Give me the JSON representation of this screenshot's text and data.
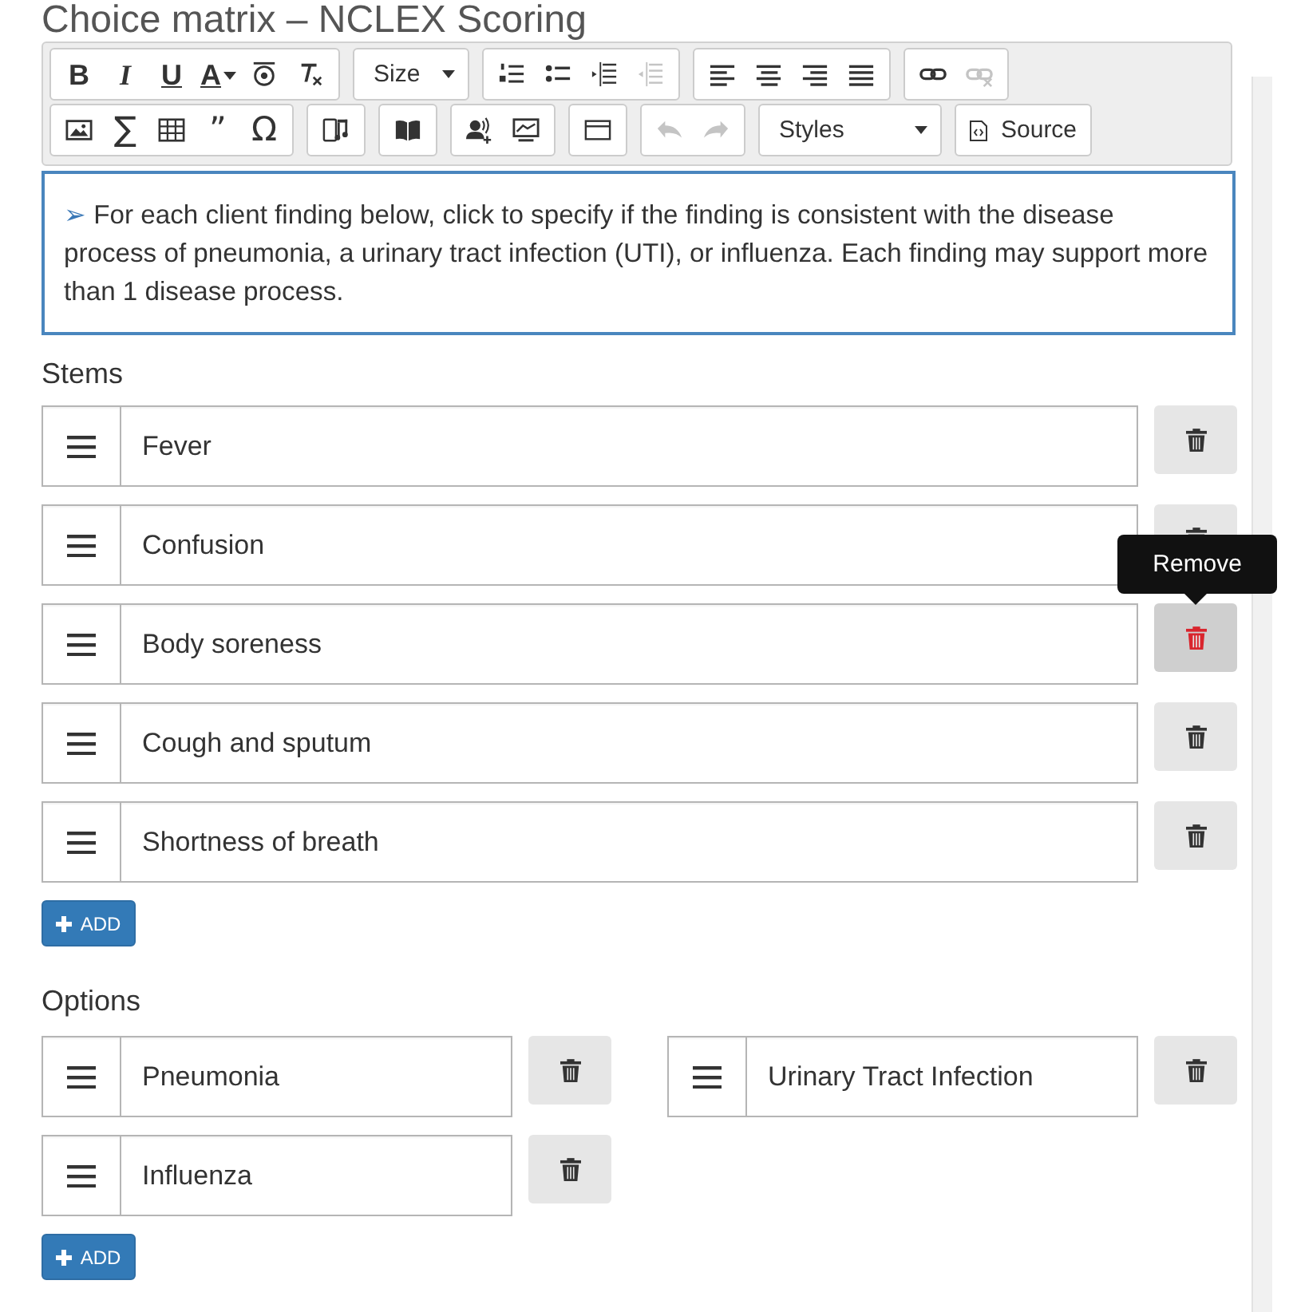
{
  "page_title": "Choice matrix – NCLEX Scoring",
  "toolbar": {
    "rows": [
      [
        {
          "items": [
            {
              "kind": "bold",
              "label": "B",
              "disabled": false
            },
            {
              "kind": "italic",
              "label": "I",
              "disabled": false
            },
            {
              "kind": "underline",
              "label": "U",
              "disabled": false
            },
            {
              "kind": "color",
              "label": "A",
              "disabled": false
            },
            {
              "kind": "ring",
              "disabled": false
            },
            {
              "kind": "clear",
              "disabled": false
            }
          ]
        },
        {
          "kind": "dropdown",
          "label": "Size"
        },
        {
          "items": [
            {
              "kind": "numlist",
              "disabled": false
            },
            {
              "kind": "bullist",
              "disabled": false
            },
            {
              "kind": "indent",
              "disabled": false
            },
            {
              "kind": "outdent",
              "disabled": true
            }
          ]
        },
        {
          "items": [
            {
              "kind": "alignleft",
              "disabled": false
            },
            {
              "kind": "aligncenter",
              "disabled": false
            },
            {
              "kind": "alignright",
              "disabled": false
            },
            {
              "kind": "justify",
              "disabled": false
            }
          ]
        },
        {
          "items": [
            {
              "kind": "link",
              "disabled": false
            },
            {
              "kind": "unlink",
              "disabled": true
            }
          ]
        }
      ],
      [
        {
          "items": [
            {
              "kind": "image",
              "disabled": false
            },
            {
              "kind": "glyph",
              "label": "∑",
              "disabled": false
            },
            {
              "kind": "table",
              "disabled": false
            },
            {
              "kind": "glyph",
              "label": "”",
              "disabled": false
            },
            {
              "kind": "glyph",
              "label": "Ω",
              "disabled": false
            }
          ]
        },
        {
          "items": [
            {
              "kind": "audio",
              "disabled": false
            }
          ]
        },
        {
          "items": [
            {
              "kind": "book",
              "disabled": false
            }
          ]
        },
        {
          "items": [
            {
              "kind": "voice",
              "disabled": false
            },
            {
              "kind": "slides",
              "disabled": false
            }
          ]
        },
        {
          "items": [
            {
              "kind": "window",
              "disabled": false
            }
          ]
        },
        {
          "items": [
            {
              "kind": "undo",
              "disabled": true
            },
            {
              "kind": "redo",
              "disabled": true
            }
          ]
        },
        {
          "kind": "dropdown",
          "label": "Styles"
        },
        {
          "kind": "source",
          "label": "Source"
        }
      ]
    ]
  },
  "instruction": {
    "marker": "➢",
    "text": "For each client finding below, click to specify if the finding is consistent with the disease process of pneumonia, a urinary tract infection (UTI), or influenza. Each finding may support more than 1 disease process."
  },
  "stems": {
    "heading": "Stems",
    "items": [
      {
        "value": "Fever",
        "hovered": false
      },
      {
        "value": "Confusion",
        "hovered": false
      },
      {
        "value": "Body soreness",
        "hovered": true,
        "tooltip": "Remove"
      },
      {
        "value": "Cough and sputum",
        "hovered": false
      },
      {
        "value": "Shortness of breath",
        "hovered": false
      }
    ],
    "add_button": "ADD"
  },
  "options": {
    "heading": "Options",
    "items": [
      {
        "value": "Pneumonia",
        "hovered": false
      },
      {
        "value": "Urinary Tract Infection",
        "hovered": false
      },
      {
        "value": "Influenza",
        "hovered": false
      }
    ],
    "add_button": "ADD"
  }
}
